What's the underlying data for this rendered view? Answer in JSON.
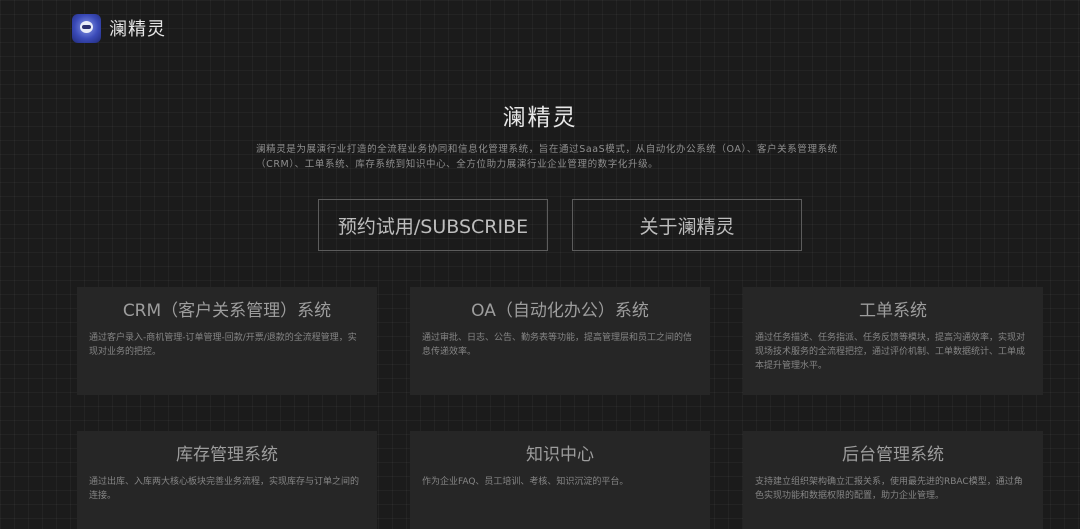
{
  "header": {
    "brand": "澜精灵",
    "logo_icon": "robot-logo-icon"
  },
  "hero": {
    "title": "澜精灵",
    "description": "澜精灵是为展演行业打造的全流程业务协同和信息化管理系统，旨在通过SaaS模式，从自动化办公系统（OA）、客户关系管理系统（CRM）、工单系统、库存系统到知识中心、全方位助力展演行业企业管理的数字化升级。"
  },
  "buttons": {
    "subscribe": "预约试用/SUBSCRIBE",
    "about": "关于澜精灵"
  },
  "features": [
    {
      "title": "CRM（客户关系管理）系统",
      "desc": "通过客户录入-商机管理-订单管理-回款/开票/退款的全流程管理，实现对业务的把控。"
    },
    {
      "title": "OA（自动化办公）系统",
      "desc": "通过审批、日志、公告、勤务表等功能，提高管理层和员工之间的信息传递效率。"
    },
    {
      "title": "工单系统",
      "desc": "通过任务描述、任务指派、任务反馈等模块，提高沟通效率，实现对现场技术服务的全流程把控，通过评价机制、工单数据统计、工单成本提升管理水平。"
    },
    {
      "title": "库存管理系统",
      "desc": "通过出库、入库两大核心板块完善业务流程，实现库存与订单之间的连接。"
    },
    {
      "title": "知识中心",
      "desc": "作为企业FAQ、员工培训、考核、知识沉淀的平台。"
    },
    {
      "title": "后台管理系统",
      "desc": "支持建立组织架构确立汇报关系，使用最先进的RBAC模型，通过角色实现功能和数据权限的配置，助力企业管理。"
    }
  ]
}
